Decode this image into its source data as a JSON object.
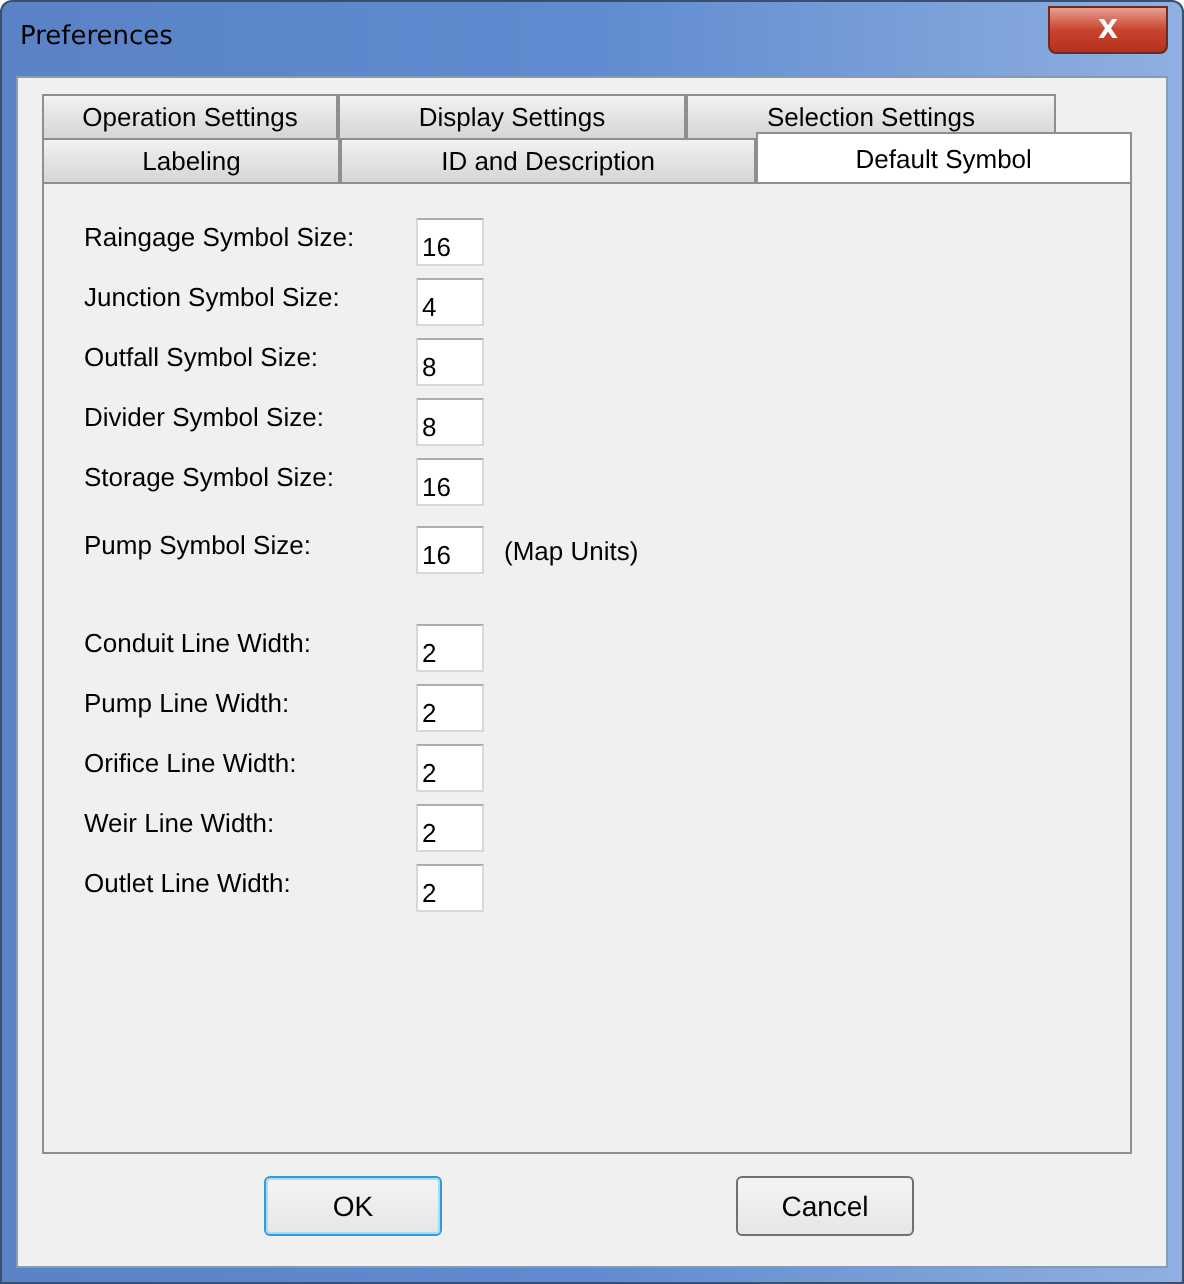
{
  "window": {
    "title": "Preferences",
    "close": "X"
  },
  "tab_rows": [
    [
      {
        "label": "Operation Settings",
        "selected": false
      },
      {
        "label": "Display Settings",
        "selected": false
      },
      {
        "label": "Selection Settings",
        "selected": false
      }
    ],
    [
      {
        "label": "Labeling",
        "selected": false
      },
      {
        "label": "ID and Description",
        "selected": false
      },
      {
        "label": "Default Symbol",
        "selected": true
      }
    ]
  ],
  "groups": [
    [
      {
        "label": "Raingage Symbol Size:",
        "value": "16"
      },
      {
        "label": "Junction Symbol Size:",
        "value": "4"
      },
      {
        "label": "Outfall Symbol Size:",
        "value": "8"
      },
      {
        "label": "Divider Symbol Size:",
        "value": "8"
      },
      {
        "label": "Storage Symbol Size:",
        "value": "16"
      },
      {
        "label": "Pump Symbol Size:",
        "value": "16",
        "unit": "(Map Units)"
      }
    ],
    [
      {
        "label": "Conduit Line Width:",
        "value": "2"
      },
      {
        "label": "Pump Line Width:",
        "value": "2"
      },
      {
        "label": "Orifice Line Width:",
        "value": "2"
      },
      {
        "label": "Weir Line Width:",
        "value": "2"
      },
      {
        "label": "Outlet Line Width:",
        "value": "2"
      }
    ]
  ],
  "buttons": [
    {
      "label": "OK",
      "focused": true
    },
    {
      "label": "Cancel",
      "focused": false
    }
  ]
}
